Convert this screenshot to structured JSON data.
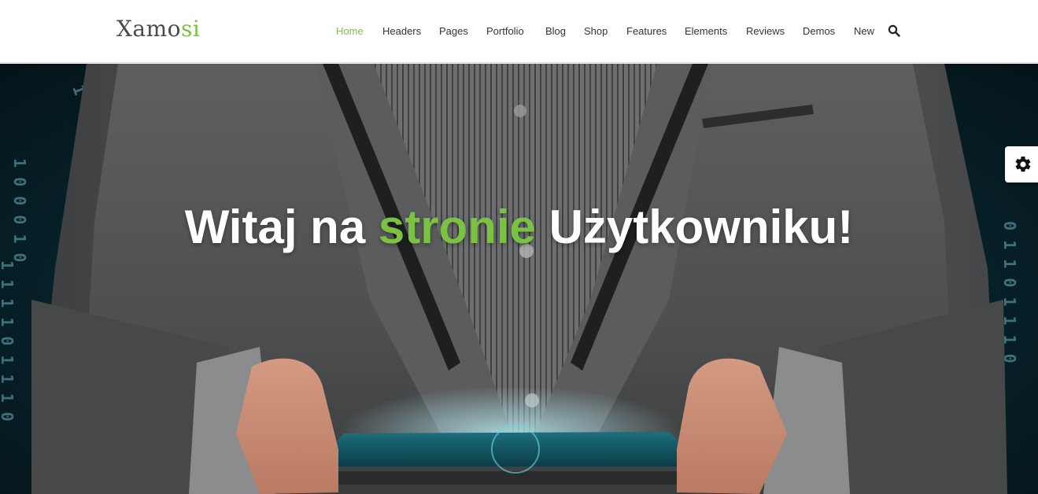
{
  "brand": {
    "name_main": "Xamo",
    "name_accent": "si",
    "accent_color": "#7cc242"
  },
  "nav": {
    "items": [
      {
        "label": "Home",
        "active": true
      },
      {
        "label": "Headers"
      },
      {
        "label": "Pages"
      },
      {
        "label": "Portfolio"
      },
      {
        "label": "Blog"
      },
      {
        "label": "Shop"
      },
      {
        "label": "Features"
      },
      {
        "label": "Elements"
      },
      {
        "label": "Reviews"
      },
      {
        "label": "Demos"
      },
      {
        "label": "New"
      }
    ],
    "search_icon": "search-icon"
  },
  "hero": {
    "title_start": "Witaj na",
    "title_highlight": "stronie",
    "title_end": "Użytkowniku!",
    "background": "man in grey suit holding glowing tablet over binary code backdrop"
  },
  "settings": {
    "icon": "gear-icon"
  }
}
